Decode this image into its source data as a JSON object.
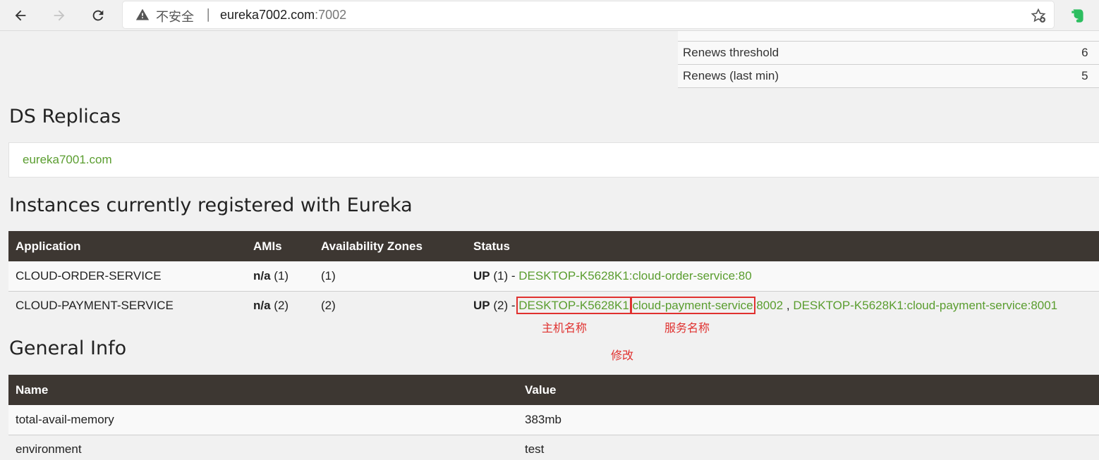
{
  "browser": {
    "insecure_label": "不安全",
    "separator": "|",
    "url_host": "eureka7002.com",
    "url_port": ":7002"
  },
  "status_rows": [
    {
      "name": "Renews threshold",
      "value": "6"
    },
    {
      "name": "Renews (last min)",
      "value": "5"
    }
  ],
  "replicas": {
    "title": "DS Replicas",
    "links": [
      "eureka7001.com"
    ]
  },
  "instances": {
    "title": "Instances currently registered with Eureka",
    "headers": [
      "Application",
      "AMIs",
      "Availability Zones",
      "Status"
    ],
    "rows": [
      {
        "application": "CLOUD-ORDER-SERVICE",
        "ami_na": "n/a",
        "ami_count": "(1)",
        "zones": "(1)",
        "status_up": "UP",
        "status_count": "(1) -",
        "link1": "DESKTOP-K5628K1:cloud-order-service:80"
      },
      {
        "application": "CLOUD-PAYMENT-SERVICE",
        "ami_na": "n/a",
        "ami_count": "(2)",
        "zones": "(2)",
        "status_up": "UP",
        "status_count": "(2) -",
        "link1_host": "DESKTOP-K5628K1",
        "link1_colon": ":",
        "link1_service": "cloud-payment-service",
        "link1_port": ":8002",
        "link_sep": ",",
        "link2": "DESKTOP-K5628K1:cloud-payment-service:8001"
      }
    ]
  },
  "annotations": {
    "host_name": "主机名称",
    "service_name": "服务名称",
    "modify": "修改",
    "color": "#e0312f"
  },
  "general": {
    "title": "General Info",
    "headers": [
      "Name",
      "Value"
    ],
    "rows": [
      {
        "name": "total-avail-memory",
        "value": "383mb"
      },
      {
        "name": "environment",
        "value": "test"
      }
    ]
  },
  "colors": {
    "header_bg": "#3d3732",
    "link_green": "#5a9d2f"
  }
}
